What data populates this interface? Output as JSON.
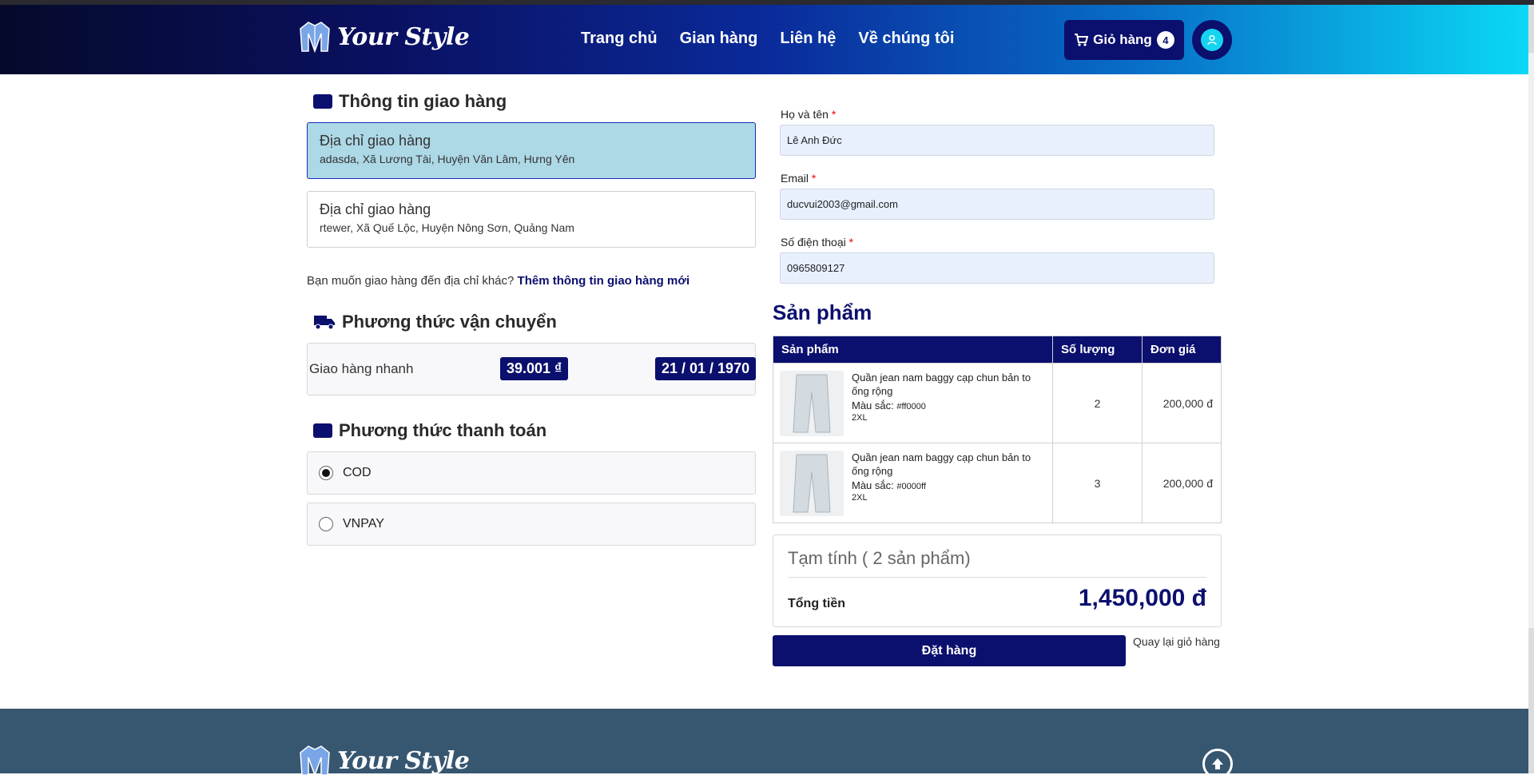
{
  "brand": {
    "name": "Your Style"
  },
  "nav": {
    "home": "Trang chủ",
    "shop": "Gian hàng",
    "contact": "Liên hệ",
    "about": "Về chúng tôi"
  },
  "cart": {
    "label": "Giỏ hàng",
    "count": "4"
  },
  "shipping_info": {
    "title": "Thông tin giao hàng",
    "addresses": [
      {
        "label": "Địa chỉ giao hàng",
        "detail": "adasda, Xã Lương Tài, Huyện Văn Lâm, Hưng Yên",
        "selected": true
      },
      {
        "label": "Địa chỉ giao hàng",
        "detail": "rtewer, Xã Quế Lộc, Huyện Nông Sơn, Quảng Nam",
        "selected": false
      }
    ],
    "other_prompt": "Bạn muốn giao hàng đến địa chỉ khác?",
    "other_link": "Thêm thông tin giao hàng mới"
  },
  "shipping_method": {
    "title": "Phương thức vận chuyển",
    "name": "Giao hàng nhanh",
    "price": "39.001 ₫",
    "date": "21 / 01 / 1970"
  },
  "payment": {
    "title": "Phương thức thanh toán",
    "options": [
      "COD",
      "VNPAY"
    ],
    "selected": "COD"
  },
  "form": {
    "name_label": "Họ và tên",
    "name_value": "Lê Anh Đức",
    "email_label": "Email",
    "email_value": "ducvui2003@gmail.com",
    "phone_label": "Số điện thoại",
    "phone_value": "0965809127",
    "required_mark": "*"
  },
  "products": {
    "title": "Sản phẩm",
    "headers": [
      "Sản phẩm",
      "Số lượng",
      "Đơn giá"
    ],
    "rows": [
      {
        "name": "Quần jean nam baggy cạp chun bản to ống rộng",
        "color_label": "Màu sắc:",
        "color": "#ff0000",
        "size": "2XL",
        "qty": "2",
        "price": "200,000 đ"
      },
      {
        "name": "Quần jean nam baggy cạp chun bản to ống rộng",
        "color_label": "Màu sắc:",
        "color": "#0000ff",
        "size": "2XL",
        "qty": "3",
        "price": "200,000 đ"
      }
    ]
  },
  "summary": {
    "subtotal": "Tạm tính ( 2 sản phẩm)",
    "total_label": "Tổng tiền",
    "total": "1,450,000 đ"
  },
  "actions": {
    "order": "Đặt hàng",
    "back": "Quay lại giỏ hàng"
  },
  "colors": {
    "primary": "#0b0f6e",
    "selected_bg": "#add8e6",
    "footer": "#375670",
    "input_bg": "#e8f0fe"
  }
}
